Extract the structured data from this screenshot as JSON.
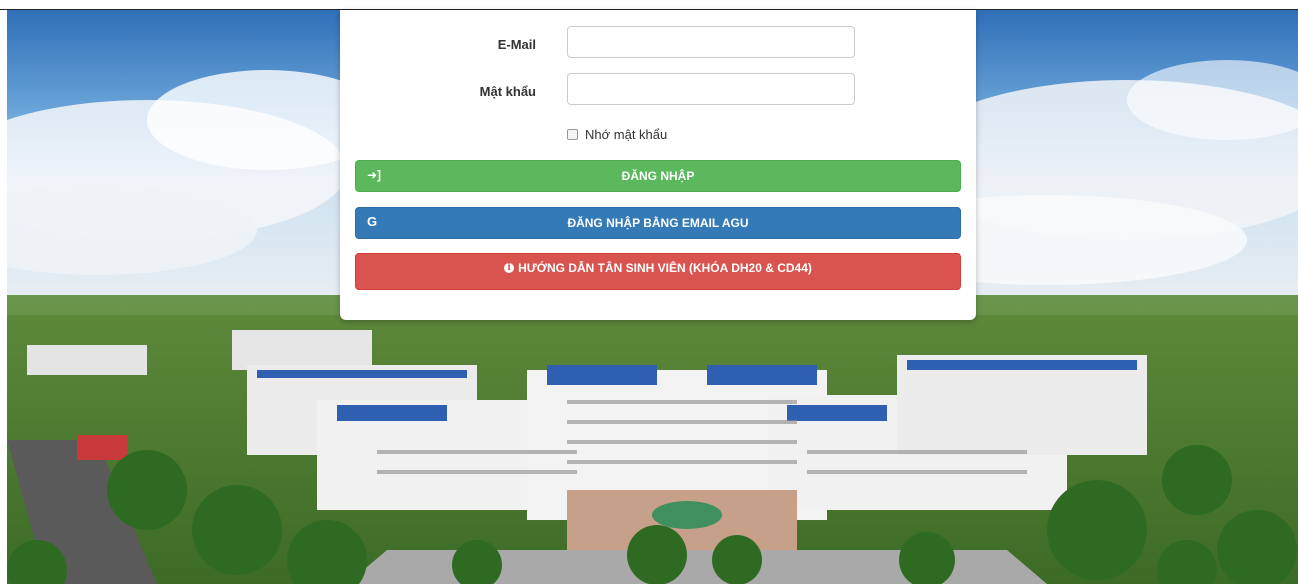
{
  "form": {
    "email_label": "E-Mail",
    "password_label": "Mật khẩu",
    "email_value": "",
    "password_value": "",
    "remember_label": "Nhớ mật khẩu",
    "remember_checked": false
  },
  "buttons": {
    "login": "ĐĂNG NHẬP",
    "login_google": "ĐĂNG NHẬP BẰNG EMAIL AGU",
    "google_icon": "G",
    "freshman_guide": "HƯỚNG DẪN TÂN SINH VIÊN (KHÓA DH20 & CD44)",
    "info_icon": "i"
  },
  "colors": {
    "login": "#5cb85c",
    "login_google": "#337ab7",
    "freshman_guide": "#d9534f"
  },
  "background": {
    "description_icon": "campus-aerial-photo"
  }
}
